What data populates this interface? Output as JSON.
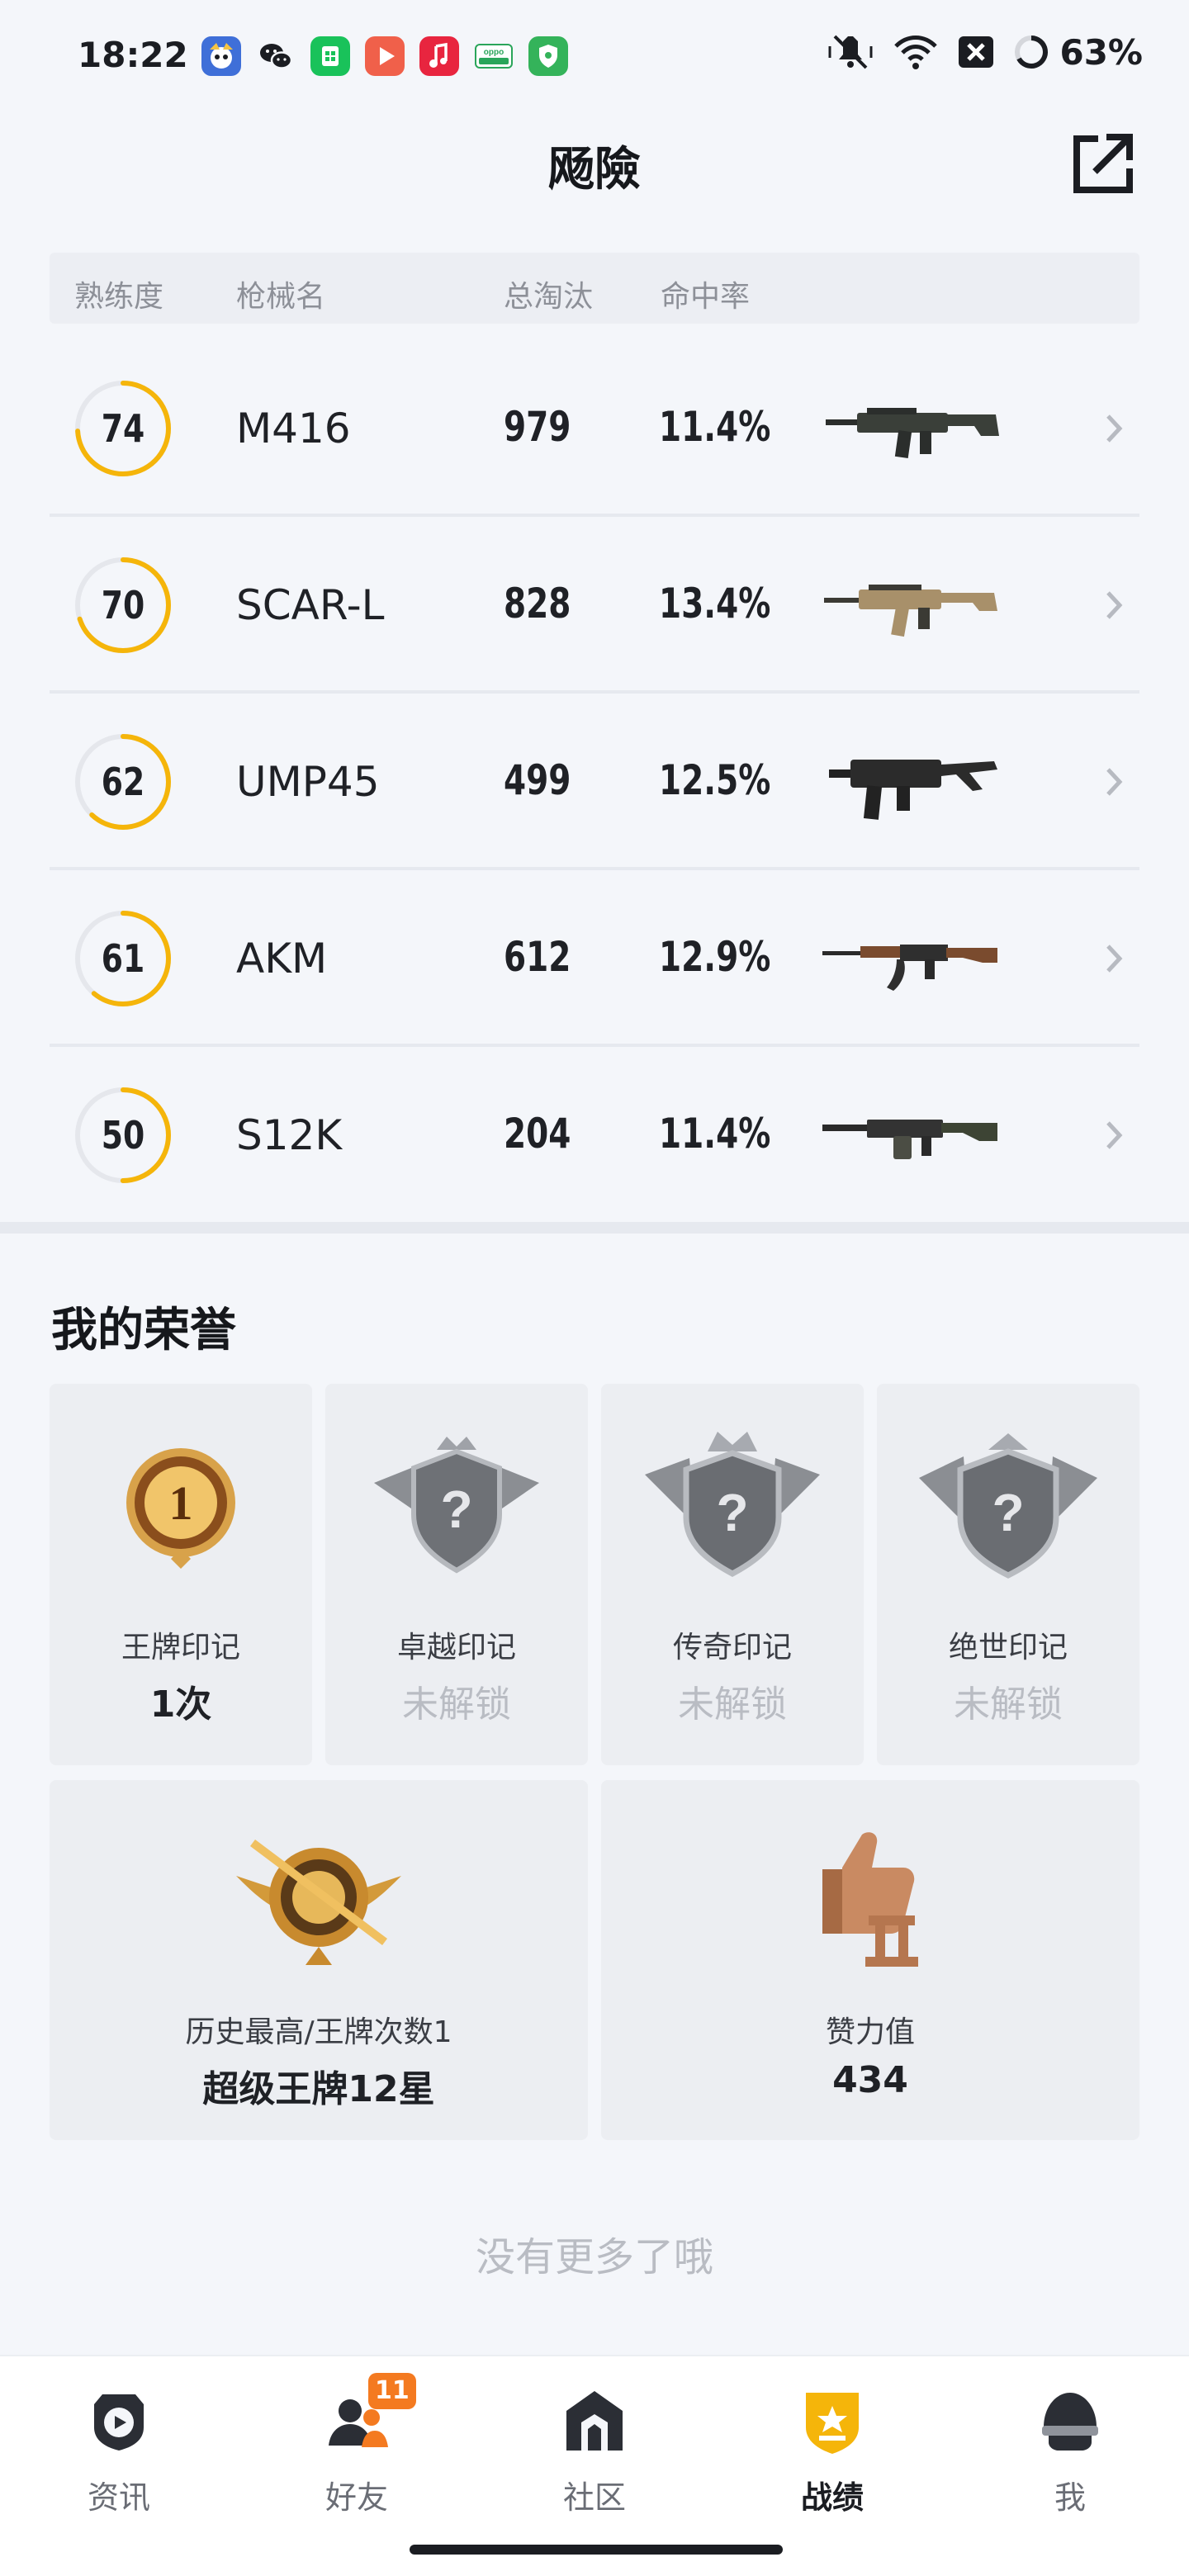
{
  "status_bar": {
    "time": "18:22",
    "battery": "63%",
    "notif_apps": [
      {
        "icon": "game-app-icon",
        "color": "#3f6fd8"
      },
      {
        "icon": "wechat-icon",
        "color": "#ffffff"
      },
      {
        "icon": "green-app-icon",
        "color": "#19c25a"
      },
      {
        "icon": "video-app-icon",
        "color": "#f0604a"
      },
      {
        "icon": "music-app-icon",
        "color": "#e8253f"
      },
      {
        "icon": "oppo-app-icon",
        "color": "#2aa55a"
      },
      {
        "icon": "security-app-icon",
        "color": "#34b35a"
      }
    ],
    "icons": [
      "mute-vibrate-icon",
      "wifi-icon",
      "close-box-icon",
      "battery-ring-icon"
    ]
  },
  "header": {
    "title": "飏險",
    "share_icon": "share-external-icon"
  },
  "weapons": {
    "columns": [
      "熟练度",
      "枪械名",
      "总淘汰",
      "命中率"
    ],
    "accent": "#f5b50a",
    "rows": [
      {
        "proficiency": "74",
        "name": "M416",
        "kills": "979",
        "hit_rate": "11.4%",
        "gun_icon": "m416-rifle-icon"
      },
      {
        "proficiency": "70",
        "name": "SCAR-L",
        "kills": "828",
        "hit_rate": "13.4%",
        "gun_icon": "scar-l-rifle-icon"
      },
      {
        "proficiency": "62",
        "name": "UMP45",
        "kills": "499",
        "hit_rate": "12.5%",
        "gun_icon": "ump45-smg-icon"
      },
      {
        "proficiency": "61",
        "name": "AKM",
        "kills": "612",
        "hit_rate": "12.9%",
        "gun_icon": "akm-rifle-icon"
      },
      {
        "proficiency": "50",
        "name": "S12K",
        "kills": "204",
        "hit_rate": "11.4%",
        "gun_icon": "s12k-shotgun-icon"
      }
    ]
  },
  "honors": {
    "title": "我的荣誉",
    "marks": [
      {
        "label": "王牌印记",
        "value": "1次",
        "unlocked": true,
        "icon": "ace-mark-gold-emblem-icon"
      },
      {
        "label": "卓越印记",
        "value": "未解锁",
        "unlocked": false,
        "icon": "excellence-mark-locked-emblem-icon"
      },
      {
        "label": "传奇印记",
        "value": "未解锁",
        "unlocked": false,
        "icon": "legend-mark-locked-emblem-icon"
      },
      {
        "label": "绝世印记",
        "value": "未解锁",
        "unlocked": false,
        "icon": "peerless-mark-locked-emblem-icon"
      }
    ],
    "history": {
      "label": "历史最高/王牌次数1",
      "value": "超级王牌12星",
      "icon": "super-ace-badge-icon"
    },
    "likes": {
      "label": "赞力值",
      "value": "434",
      "icon": "thumbs-up-trophy-icon"
    }
  },
  "footer_text": "没有更多了哦",
  "bottom_nav": {
    "items": [
      {
        "label": "资讯",
        "icon": "news-play-icon",
        "active": false
      },
      {
        "label": "好友",
        "icon": "friends-icon",
        "active": false,
        "badge": "11"
      },
      {
        "label": "社区",
        "icon": "community-house-icon",
        "active": false
      },
      {
        "label": "战绩",
        "icon": "record-shield-icon",
        "active": true
      },
      {
        "label": "我",
        "icon": "helmet-profile-icon",
        "active": false
      }
    ]
  }
}
